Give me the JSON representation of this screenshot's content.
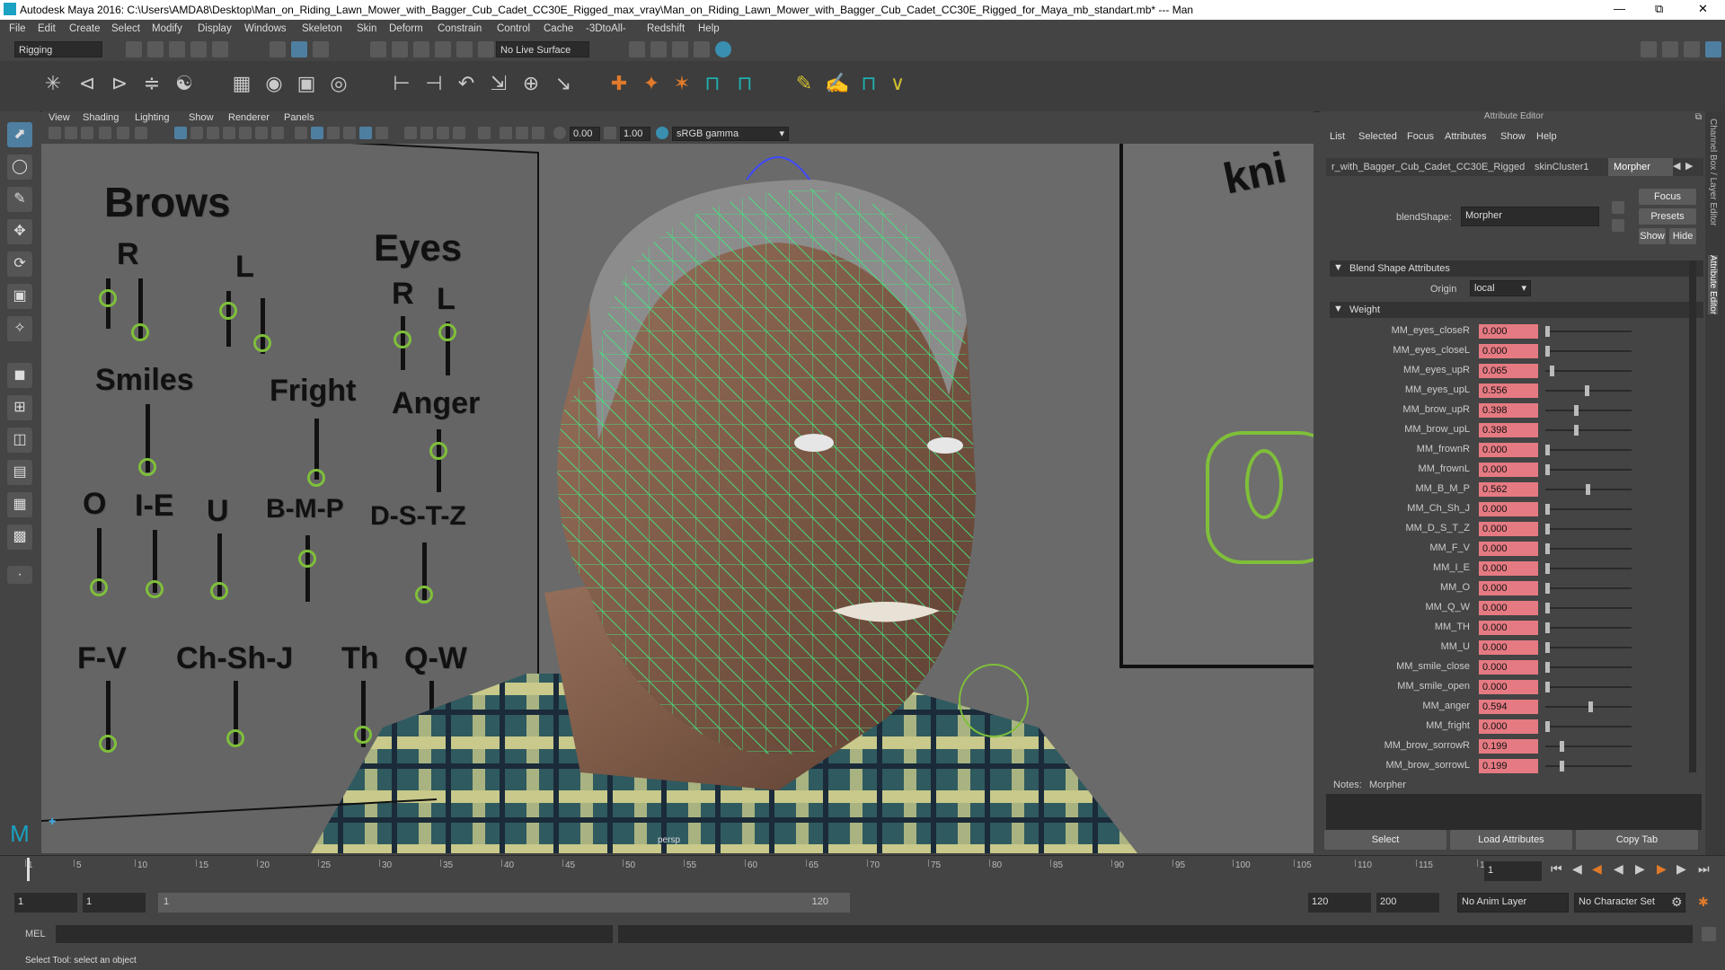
{
  "window": {
    "title": "Autodesk Maya 2016: C:\\Users\\AMDA8\\Desktop\\Man_on_Riding_Lawn_Mower_with_Bagger_Cub_Cadet_CC30E_Rigged_max_vray\\Man_on_Riding_Lawn_Mower_with_Bagger_Cub_Cadet_CC30E_Rigged_for_Maya_mb_standart.mb*  ---  Man"
  },
  "menubar": [
    "File",
    "Edit",
    "Create",
    "Select",
    "Modify",
    "Display",
    "Windows",
    "Skeleton",
    "Skin",
    "Deform",
    "Constrain",
    "Control",
    "Cache",
    "-3DtoAll-",
    "Redshift",
    "Help"
  ],
  "statusline": {
    "menuset": "Rigging",
    "live_surface": "No Live Surface"
  },
  "viewport": {
    "menu": [
      "View",
      "Shading",
      "Lighting",
      "Show",
      "Renderer",
      "Panels"
    ],
    "exposure": "0.00",
    "gamma": "1.00",
    "colorspace": "sRGB gamma",
    "camera_label": "persp",
    "controls": {
      "brows": "Brows",
      "brows_r": "R",
      "brows_l": "L",
      "eyes": "Eyes",
      "eyes_r": "R",
      "eyes_l": "L",
      "smiles": "Smiles",
      "fright": "Fright",
      "anger": "Anger",
      "o": "O",
      "ie": "I-E",
      "u": "U",
      "bmp": "B-M-P",
      "dstz": "D-S-T-Z",
      "fv": "F-V",
      "chshj": "Ch-Sh-J",
      "th": "Th",
      "qw": "Q-W",
      "partial_text": "kni"
    }
  },
  "attribute_editor": {
    "header": "Attribute Editor",
    "menu": [
      "List",
      "Selected",
      "Focus",
      "Attributes",
      "Show",
      "Help"
    ],
    "tabs": [
      "r_with_Bagger_Cub_Cadet_CC30E_Rigged",
      "skinCluster1",
      "Morpher"
    ],
    "active_tab": "Morpher",
    "blendshape_label": "blendShape:",
    "blendshape_value": "Morpher",
    "buttons": {
      "focus": "Focus",
      "presets": "Presets",
      "show": "Show",
      "hide": "Hide"
    },
    "section_blend": "Blend Shape Attributes",
    "origin_label": "Origin",
    "origin_value": "local",
    "section_weight": "Weight",
    "weights": [
      {
        "name": "MM_eyes_closeR",
        "value": "0.000",
        "level": 0.0
      },
      {
        "name": "MM_eyes_closeL",
        "value": "0.000",
        "level": 0.0
      },
      {
        "name": "MM_eyes_upR",
        "value": "0.065",
        "level": 0.065
      },
      {
        "name": "MM_eyes_upL",
        "value": "0.556",
        "level": 0.556
      },
      {
        "name": "MM_brow_upR",
        "value": "0.398",
        "level": 0.398
      },
      {
        "name": "MM_brow_upL",
        "value": "0.398",
        "level": 0.398
      },
      {
        "name": "MM_frownR",
        "value": "0.000",
        "level": 0.0
      },
      {
        "name": "MM_frownL",
        "value": "0.000",
        "level": 0.0
      },
      {
        "name": "MM_B_M_P",
        "value": "0.562",
        "level": 0.562
      },
      {
        "name": "MM_Ch_Sh_J",
        "value": "0.000",
        "level": 0.0
      },
      {
        "name": "MM_D_S_T_Z",
        "value": "0.000",
        "level": 0.0
      },
      {
        "name": "MM_F_V",
        "value": "0.000",
        "level": 0.0
      },
      {
        "name": "MM_I_E",
        "value": "0.000",
        "level": 0.0
      },
      {
        "name": "MM_O",
        "value": "0.000",
        "level": 0.0
      },
      {
        "name": "MM_Q_W",
        "value": "0.000",
        "level": 0.0
      },
      {
        "name": "MM_TH",
        "value": "0.000",
        "level": 0.0
      },
      {
        "name": "MM_U",
        "value": "0.000",
        "level": 0.0
      },
      {
        "name": "MM_smile_close",
        "value": "0.000",
        "level": 0.0
      },
      {
        "name": "MM_smile_open",
        "value": "0.000",
        "level": 0.0
      },
      {
        "name": "MM_anger",
        "value": "0.594",
        "level": 0.594
      },
      {
        "name": "MM_fright",
        "value": "0.000",
        "level": 0.0
      },
      {
        "name": "MM_brow_sorrowR",
        "value": "0.199",
        "level": 0.199
      },
      {
        "name": "MM_brow_sorrowL",
        "value": "0.199",
        "level": 0.199
      }
    ],
    "notes_label": "Notes:",
    "notes_value": "Morpher",
    "bottom_buttons": [
      "Select",
      "Load Attributes",
      "Copy Tab"
    ],
    "side_tabs": [
      "Channel Box / Layer Editor",
      "Attribute Editor"
    ]
  },
  "timeline": {
    "ticks": [
      "1",
      "5",
      "10",
      "15",
      "20",
      "25",
      "30",
      "35",
      "40",
      "45",
      "50",
      "55",
      "60",
      "65",
      "70",
      "75",
      "80",
      "85",
      "90",
      "95",
      "100",
      "105",
      "110",
      "115",
      "120"
    ],
    "current_frame": "1"
  },
  "range": {
    "start": "1",
    "start2": "1",
    "slider_start": "1",
    "slider_end": "120",
    "end": "120",
    "end2": "200",
    "anim_layer": "No Anim Layer",
    "char_set": "No Character Set"
  },
  "cmdline": {
    "label": "MEL"
  },
  "helpline": {
    "text": "Select Tool: select an object"
  }
}
